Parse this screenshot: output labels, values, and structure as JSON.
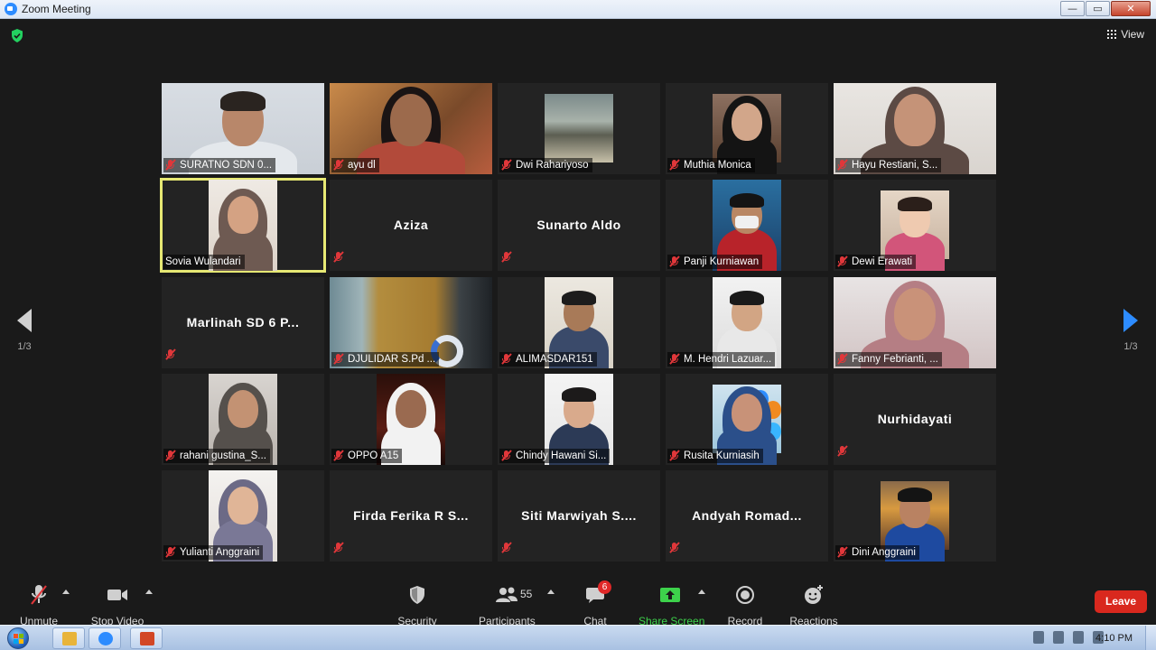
{
  "window": {
    "title": "Zoom Meeting",
    "minimize": "—",
    "restore": "▭",
    "close": "✕"
  },
  "header": {
    "view_label": "View"
  },
  "pagination": {
    "left_label": "1/3",
    "right_label": "1/3"
  },
  "participants": [
    {
      "name": "SURATNO SDN 0...",
      "video": "man-1"
    },
    {
      "name": "ayu dl",
      "video": "girl-room"
    },
    {
      "name": "Dwi Rahariyoso",
      "video": "beach"
    },
    {
      "name": "Muthia Monica",
      "video": "hijab-dark"
    },
    {
      "name": "Hayu Restiani, S...",
      "video": "hijab-light"
    },
    {
      "name": "Sovia Wulandari",
      "video": "hijab-glasses",
      "active": true
    },
    {
      "name": "Aziza",
      "video": "none"
    },
    {
      "name": "Sunarto Aldo",
      "video": "none"
    },
    {
      "name": "Panji Kurniawan",
      "video": "man-mask"
    },
    {
      "name": "Dewi Erawati",
      "video": "mother-child"
    },
    {
      "name": "Marlinah SD 6 P...",
      "video": "none"
    },
    {
      "name": "DJULIDAR S.Pd ...",
      "video": "wardrobe"
    },
    {
      "name": "ALIMASDAR151",
      "video": "man-wall"
    },
    {
      "name": "M. Hendri Lazuar...",
      "video": "man-glasses"
    },
    {
      "name": "Fanny Febrianti, ...",
      "video": "hijab-pink"
    },
    {
      "name": "rahani gustina_S...",
      "video": "hijab-grey"
    },
    {
      "name": "OPPO A15",
      "video": "dark-white-hijab"
    },
    {
      "name": "Chindy Hawani Si...",
      "video": "woman-glasses"
    },
    {
      "name": "Rusita Kurniasih",
      "video": "balloons"
    },
    {
      "name": "Nurhidayati",
      "video": "none"
    },
    {
      "name": "Yulianti Anggraini",
      "video": "hijab-portrait"
    },
    {
      "name": "Firda Ferika R S...",
      "video": "none"
    },
    {
      "name": "Siti Marwiyah S....",
      "video": "none"
    },
    {
      "name": "Andyah Romad...",
      "video": "none"
    },
    {
      "name": "Dini Anggraini",
      "video": "couple-lights"
    }
  ],
  "toolbar": {
    "unmute": "Unmute",
    "stop_video": "Stop Video",
    "security": "Security",
    "participants": "Participants",
    "participants_count": "55",
    "chat": "Chat",
    "chat_badge": "6",
    "share_screen": "Share Screen",
    "record": "Record",
    "reactions": "Reactions",
    "leave": "Leave"
  },
  "taskbar": {
    "clock": "4:10 PM"
  },
  "colors": {
    "accent": "#2d8cff",
    "share": "#3dd24b",
    "leave": "#d9281e",
    "active_speaker": "#e6e873",
    "muted": "#e0373a"
  }
}
